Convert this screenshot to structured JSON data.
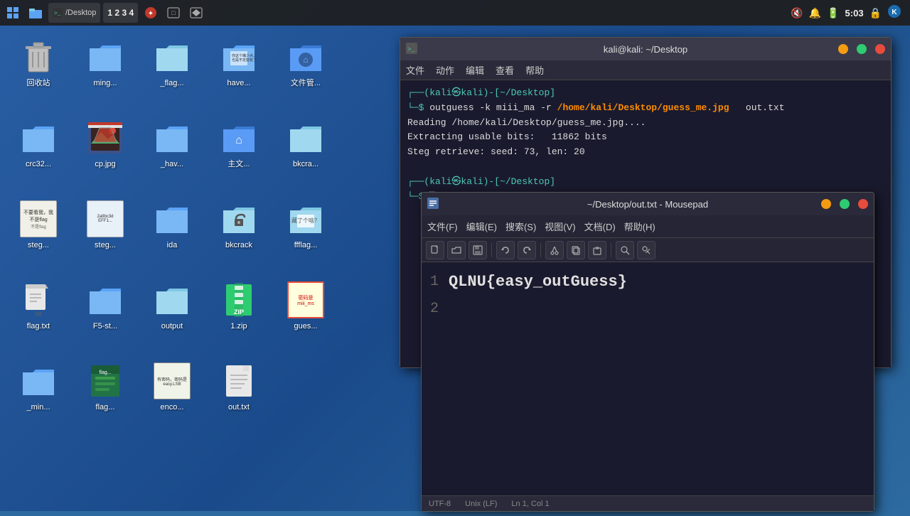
{
  "taskbar": {
    "time": "5:03",
    "apps": [
      {
        "name": "system-monitor",
        "label": "⊞"
      },
      {
        "name": "file-manager",
        "label": "📁"
      },
      {
        "name": "terminal",
        "label": ">_"
      },
      {
        "name": "number-app",
        "label": "1 2 3 4"
      },
      {
        "name": "red-app",
        "label": "🔴"
      },
      {
        "name": "terminal2",
        "label": "□"
      },
      {
        "name": "app6",
        "label": "⬜"
      }
    ],
    "right_icons": [
      "🔇",
      "🔔",
      "🔋"
    ]
  },
  "desktop_icons": [
    {
      "id": "trash",
      "label": "回收站",
      "type": "trash"
    },
    {
      "id": "ming",
      "label": "ming...",
      "type": "folder-blue"
    },
    {
      "id": "flag1",
      "label": "_flag...",
      "type": "folder-light"
    },
    {
      "id": "have",
      "label": "have...",
      "type": "folder-blue"
    },
    {
      "id": "file-manager",
      "label": "文件管...",
      "type": "folder-dark"
    },
    {
      "id": "crc32",
      "label": "crc32...",
      "type": "folder-blue"
    },
    {
      "id": "cpjpg",
      "label": "cp.jpg",
      "type": "img-red"
    },
    {
      "id": "hav2",
      "label": "_hav...",
      "type": "folder-blue"
    },
    {
      "id": "main",
      "label": "主文...",
      "type": "folder-blue"
    },
    {
      "id": "bkcra",
      "label": "bkcra...",
      "type": "folder-light"
    },
    {
      "id": "steg1",
      "label": "steg...",
      "type": "img-note"
    },
    {
      "id": "steg2",
      "label": "steg...",
      "type": "img-note2"
    },
    {
      "id": "ida",
      "label": "ida",
      "type": "folder-blue"
    },
    {
      "id": "bkcrack",
      "label": "bkcrack",
      "type": "folder-lock"
    },
    {
      "id": "ffflag",
      "label": "ffflag...",
      "type": "folder-text"
    },
    {
      "id": "flagtxt",
      "label": "flag.txt",
      "type": "file-txt"
    },
    {
      "id": "f5st",
      "label": "F5-st...",
      "type": "folder-blue"
    },
    {
      "id": "output",
      "label": "output",
      "type": "folder-light"
    },
    {
      "id": "zip1",
      "label": "1.zip",
      "type": "zip-green"
    },
    {
      "id": "gues",
      "label": "gues...",
      "type": "img-red2"
    },
    {
      "id": "min2",
      "label": "_min...",
      "type": "folder-blue"
    },
    {
      "id": "flagx",
      "label": "flag...",
      "type": "file-xlsx"
    },
    {
      "id": "enco",
      "label": "enco...",
      "type": "img-lsb"
    },
    {
      "id": "outtxt",
      "label": "out.txt",
      "type": "file-doc"
    }
  ],
  "terminal": {
    "title": "kali@kali: ~/Desktop",
    "menu": [
      "文件",
      "动作",
      "编辑",
      "查看",
      "帮助"
    ],
    "lines": [
      {
        "type": "prompt",
        "text": "┌──(kali㉿kali)-[~/Desktop]"
      },
      {
        "type": "cmd",
        "text": "└─$ outguess -k miii_ma -r /home/kali/Desktop/guess_me.jpg   out.txt"
      },
      {
        "type": "output",
        "text": "Reading /home/kali/Desktop/guess_me.jpg...."
      },
      {
        "type": "output",
        "text": "Extracting usable bits:   11862 bits"
      },
      {
        "type": "output",
        "text": "Steg retrieve: seed: 73, len: 20"
      },
      {
        "type": "prompt2",
        "text": "┌──(kali㉿kali)-[~/Desktop]"
      },
      {
        "type": "cursor",
        "text": "└─$ "
      }
    ]
  },
  "mousepad": {
    "title": "~/Desktop/out.txt - Mousepad",
    "menu": [
      "文件(F)",
      "编辑(E)",
      "搜索(S)",
      "视图(V)",
      "文档(D)",
      "帮助(H)"
    ],
    "content_line1": "QLNU{easy_outGuess}",
    "content_line2": "",
    "line1_num": "1",
    "line2_num": "2",
    "status": {
      "encoding": "UTF-8",
      "line_ending": "Unix (LF)",
      "position": "Ln 1, Col 1"
    }
  }
}
